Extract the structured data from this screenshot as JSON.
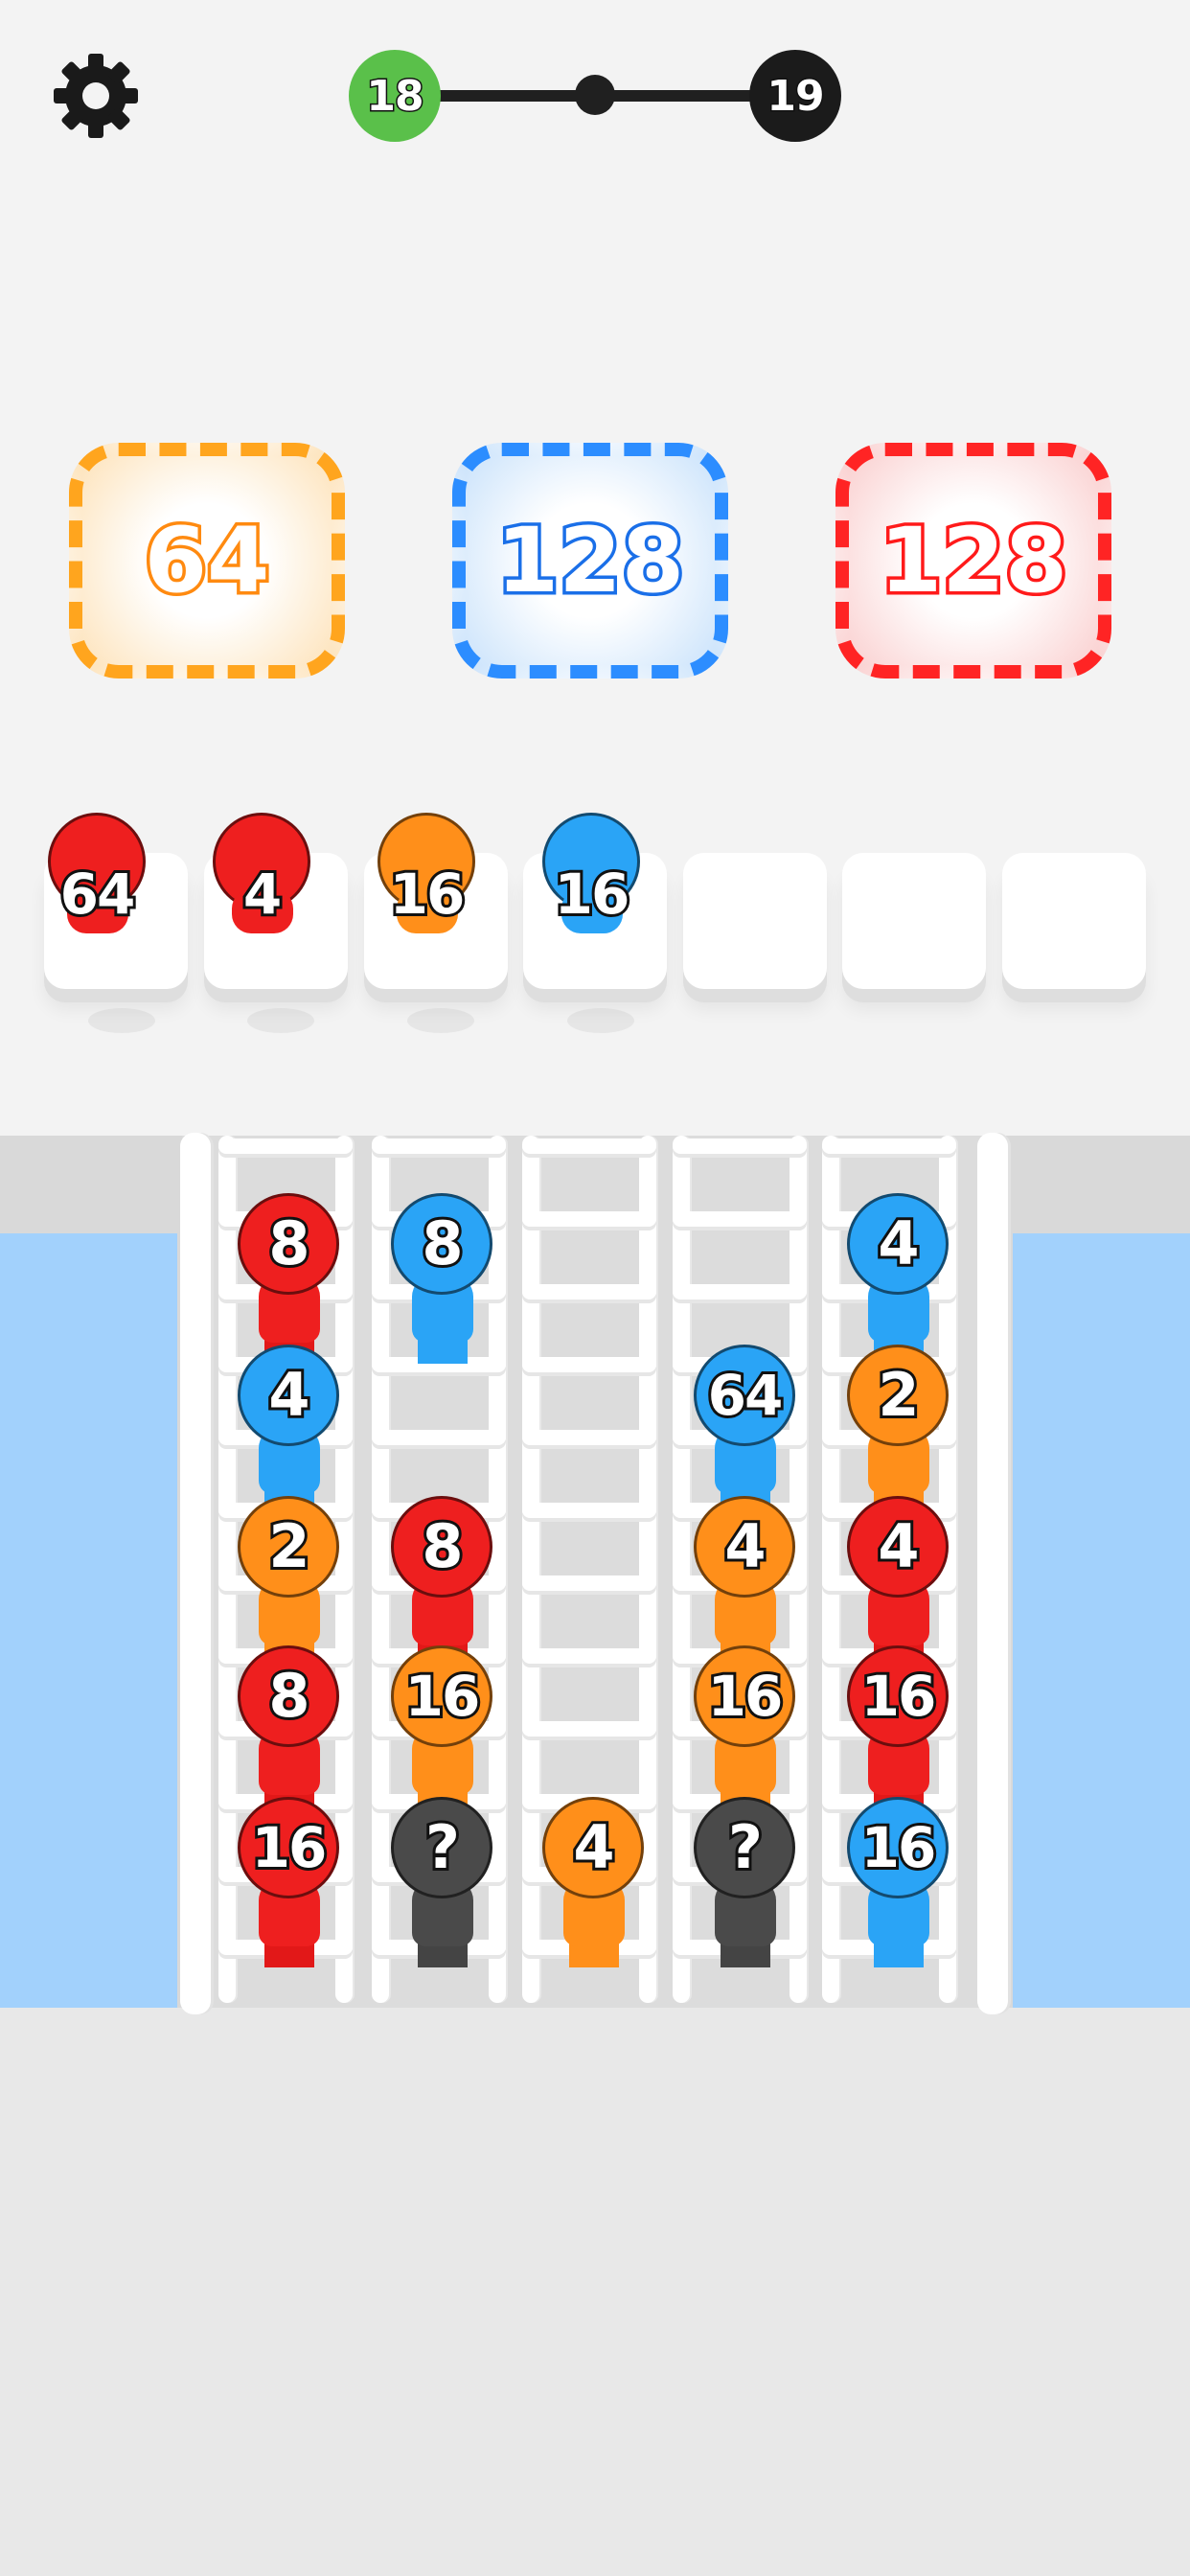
{
  "header": {
    "settings_icon": "gear-icon",
    "level_current": "18",
    "level_next": "19",
    "colors": {
      "current": "#5ac04a",
      "next": "#1b1b1b"
    }
  },
  "targets": [
    {
      "color": "orange",
      "value": "64"
    },
    {
      "color": "blue",
      "value": "128"
    },
    {
      "color": "red",
      "value": "128"
    }
  ],
  "slots": [
    {
      "color": "red",
      "value": "64"
    },
    {
      "color": "red",
      "value": "4"
    },
    {
      "color": "orange",
      "value": "16"
    },
    {
      "color": "blue",
      "value": "16"
    },
    {
      "empty": true
    },
    {
      "empty": true
    },
    {
      "empty": true
    }
  ],
  "columns": [
    [
      {
        "color": "red",
        "value": "8"
      },
      {
        "color": "blue",
        "value": "4"
      },
      {
        "color": "orange",
        "value": "2"
      },
      {
        "color": "red",
        "value": "8"
      },
      {
        "color": "red",
        "value": "16"
      }
    ],
    [
      {
        "color": "blue",
        "value": "8"
      },
      null,
      {
        "color": "red",
        "value": "8"
      },
      {
        "color": "orange",
        "value": "16"
      },
      {
        "color": "gray",
        "value": "?"
      }
    ],
    [
      null,
      null,
      null,
      null,
      {
        "color": "orange",
        "value": "4"
      }
    ],
    [
      null,
      {
        "color": "blue",
        "value": "64"
      },
      {
        "color": "orange",
        "value": "4"
      },
      {
        "color": "orange",
        "value": "16"
      },
      {
        "color": "gray",
        "value": "?"
      }
    ],
    [
      {
        "color": "blue",
        "value": "4"
      },
      {
        "color": "orange",
        "value": "2"
      },
      {
        "color": "red",
        "value": "4"
      },
      {
        "color": "red",
        "value": "16"
      },
      {
        "color": "blue",
        "value": "16"
      }
    ]
  ]
}
